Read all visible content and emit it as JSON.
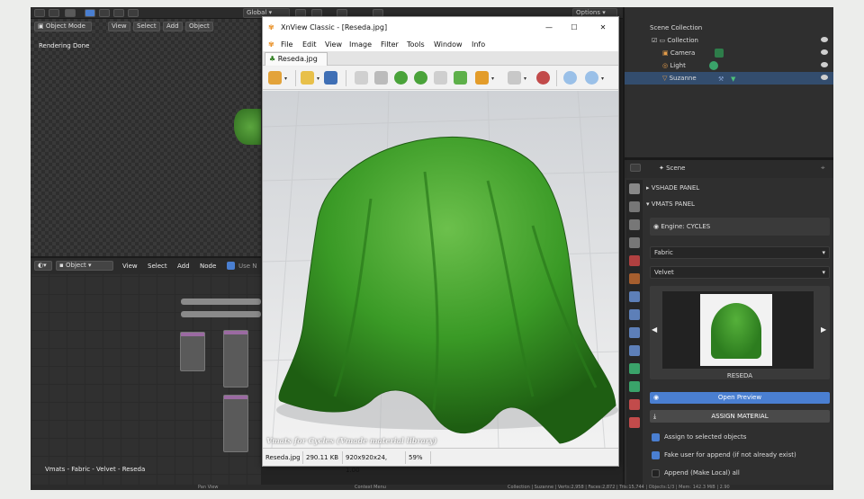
{
  "blender": {
    "header": {
      "transform_orientation": "Global",
      "options": "Options"
    },
    "viewport": {
      "mode": "Object Mode",
      "menus": [
        "View",
        "Select",
        "Add",
        "Object"
      ],
      "render_status": "Rendering Done"
    },
    "node_editor": {
      "type": "Object",
      "menus": [
        "View",
        "Select",
        "Add",
        "Node"
      ],
      "use_nodes": "Use N",
      "footer": "Vmats - Fabric - Velvet - Reseda"
    },
    "outliner": {
      "scene_collection": "Scene Collection",
      "items": [
        "Collection",
        "Camera",
        "Light",
        "Suzanne"
      ]
    },
    "properties": {
      "context": "Scene",
      "sections": [
        "VSHADE PANEL",
        "VMATS PANEL"
      ],
      "engine": "Engine: CYCLES",
      "category": "Fabric",
      "material": "Velvet",
      "preview_name": "RESEDA",
      "open_preview": "Open Preview",
      "assign_material": "ASSIGN MATERIAL",
      "options": [
        {
          "label": "Assign to selected objects",
          "checked": true
        },
        {
          "label": "Fake user for append (if not already exist)",
          "checked": true
        },
        {
          "label": "Append (Make Local) all",
          "checked": false
        }
      ]
    },
    "status_bar": {
      "left": "Pan View",
      "middle": "Context Menu",
      "right": "Collection | Suzanne | Verts:2,958 | Faces:2,872 | Tris:15,744 | Objects:1/3 | Mem: 142.3 MiB | 2.90"
    }
  },
  "xnview": {
    "title": "XnView Classic - [Reseda.jpg]",
    "menu": [
      "File",
      "Edit",
      "View",
      "Image",
      "Filter",
      "Tools",
      "Window",
      "Info"
    ],
    "tab": "Reseda.jpg",
    "caption": "Vmats for Cycles (Vmade material library)",
    "status": {
      "filename": "Reseda.jpg",
      "size": "290.11 KB",
      "dimensions": "920x920x24, 1.00",
      "zoom": "59%"
    }
  },
  "colors": {
    "velvet_green": "#3f9a2a",
    "blender_accent": "#4a7fd1",
    "xnview_bg": "#f0f0f0"
  }
}
